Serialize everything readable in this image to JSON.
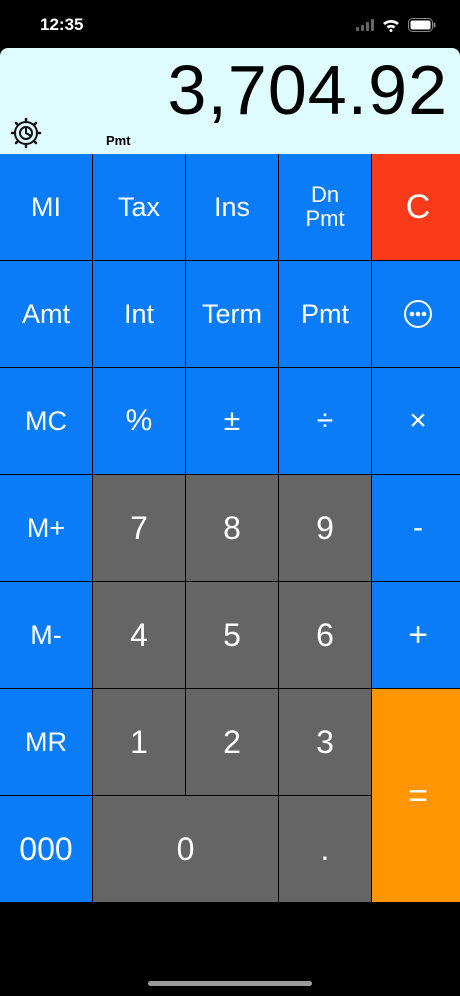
{
  "status": {
    "time": "12:35"
  },
  "display": {
    "value": "3,704.92",
    "mode": "Pmt"
  },
  "keys": {
    "mi": "MI",
    "tax": "Tax",
    "ins": "Ins",
    "dn_pmt_1": "Dn",
    "dn_pmt_2": "Pmt",
    "clear": "C",
    "amt": "Amt",
    "int": "Int",
    "term": "Term",
    "pmt": "Pmt",
    "mc": "MC",
    "percent": "%",
    "plus_minus": "±",
    "divide": "÷",
    "multiply": "×",
    "m_plus": "M+",
    "seven": "7",
    "eight": "8",
    "nine": "9",
    "minus": "-",
    "m_minus": "M-",
    "four": "4",
    "five": "5",
    "six": "6",
    "plus": "+",
    "mr": "MR",
    "one": "1",
    "two": "2",
    "three": "3",
    "equals": "=",
    "triple_zero": "000",
    "zero": "0",
    "decimal": "."
  },
  "colors": {
    "blue": "#0a7cf7",
    "gray": "#656565",
    "red": "#fb3a1a",
    "orange": "#ff9500",
    "display": "#dffcff"
  },
  "icons": {
    "settings": "gear-icon",
    "more": "more-icon"
  }
}
